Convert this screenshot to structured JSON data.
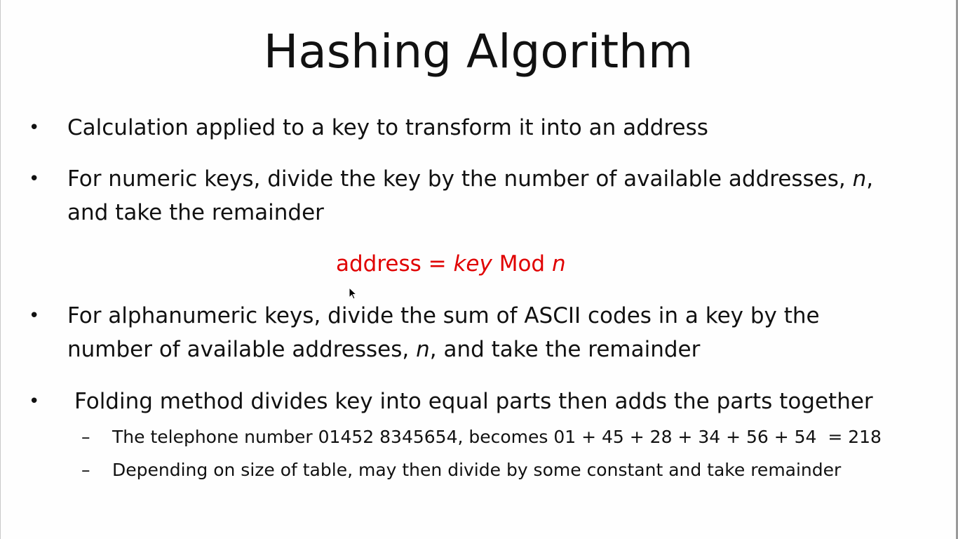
{
  "slide": {
    "title": "Hashing Algorithm",
    "bullet_glyph": "•",
    "sub_glyph": "–",
    "bullets": [
      {
        "text": "Calculation applied to a key to transform it into an address"
      },
      {
        "line1_pre": "For numeric keys, divide the key by the number of available addresses, ",
        "var": "n",
        "line1_post": ",",
        "line2": "and take the remainder"
      },
      {
        "line1": "For alphanumeric keys, divide the sum of ASCII codes in a key by the",
        "line2_pre": "number of available addresses, ",
        "var": "n",
        "line2_post": ", and take the remainder"
      },
      {
        "text": "Folding method divides key into equal parts then adds the parts together"
      }
    ],
    "formula": {
      "lhs": "address = ",
      "key": "key",
      "op": " Mod ",
      "n": "n",
      "color": "#e00000"
    },
    "subbullets": [
      {
        "text": "The telephone number 01452 8345654, becomes 01 + 45 + 28 + 34 + 56 + 54  = 218"
      },
      {
        "text": "Depending on size of table, may then divide by some constant and take remainder"
      }
    ]
  }
}
